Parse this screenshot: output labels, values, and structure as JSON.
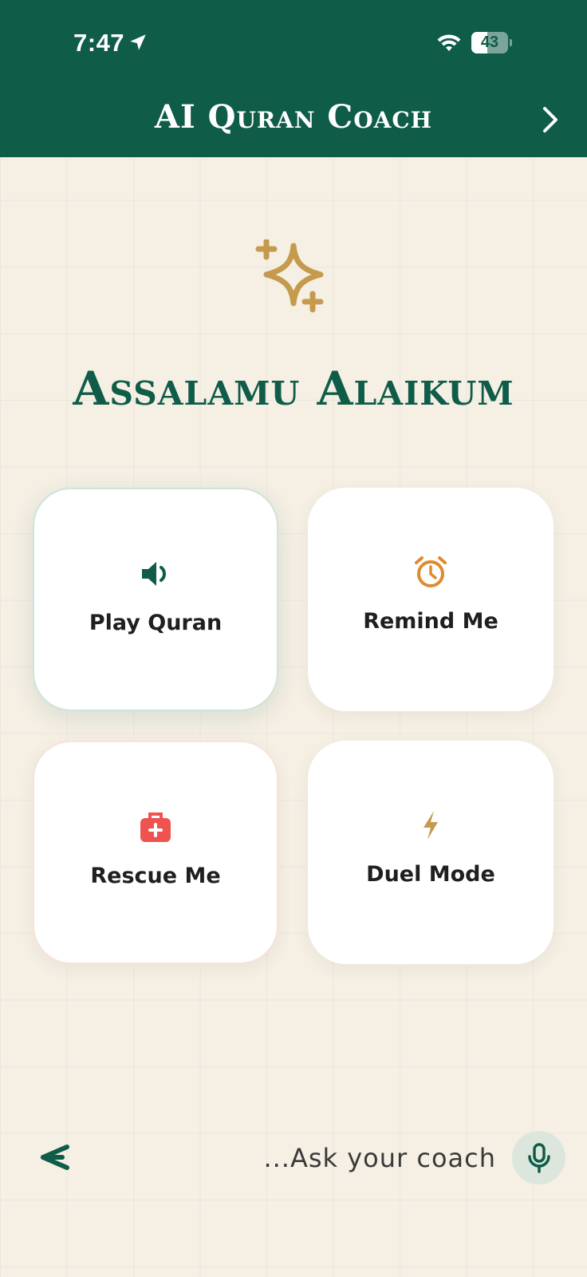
{
  "status_bar": {
    "time": "7:47",
    "battery": "43",
    "battery_level": 0.43,
    "icons": [
      "location-arrow-icon",
      "wifi-icon",
      "battery-icon"
    ]
  },
  "header": {
    "title": "AI Quran Coach",
    "forward_icon": "chevron-right-icon",
    "background_color": "#0f5c49"
  },
  "hero": {
    "icon": "sparkle-icon",
    "icon_color": "#c59a4d",
    "greeting": "Assalamu Alaikum"
  },
  "actions": [
    {
      "label": "Play Quran",
      "icon": "speaker-icon",
      "icon_color": "#0f5c49"
    },
    {
      "label": "Remind Me",
      "icon": "alarm-clock-icon",
      "icon_color": "#e08a2e"
    },
    {
      "label": "Rescue Me",
      "icon": "first-aid-kit-icon",
      "icon_color": "#ef5350"
    },
    {
      "label": "Duel Mode",
      "icon": "lightning-icon",
      "icon_color": "#c59a4d"
    }
  ],
  "bottom_bar": {
    "back_icon": "back-arrow-icon",
    "placeholder": "...Ask your coach",
    "mic_icon": "microphone-icon"
  }
}
